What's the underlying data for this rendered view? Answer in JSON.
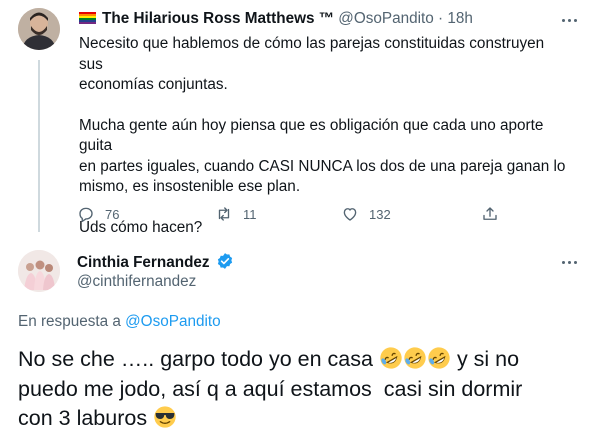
{
  "tweet": {
    "author_name": "The Hilarious Ross Matthews",
    "author_badge": "™",
    "handle": "@OsoPandito",
    "separator": "·",
    "time": "18h",
    "text_lines": [
      "Necesito que hablemos de cómo las parejas constituidas construyen sus",
      "economías conjuntas.",
      "Mucha gente aún hoy piensa que es obligación que cada uno aporte guita",
      "en partes iguales, cuando CASI NUNCA los dos de una pareja ganan lo",
      "mismo, es insostenible ese plan.",
      "Uds cómo hacen?"
    ],
    "actions": {
      "reply_count": "76",
      "retweet_count": "11",
      "like_count": "132"
    }
  },
  "reply": {
    "author_name": "Cinthia Fernandez",
    "handle": "@cinthifernandez",
    "replying_prefix": "En respuesta a",
    "replying_to": "@OsoPandito",
    "text_part1": "No se che ….. garpo todo yo en casa",
    "text_part2": "y si no",
    "text_line2": "puedo me jodo, así q a aquí estamos  casi sin dormir",
    "text_line3": "con 3 laburos",
    "emojis": [
      "rolling-on-floor-laughing",
      "rolling-on-floor-laughing",
      "rolling-on-floor-laughing",
      "smiling-face-with-sunglasses"
    ]
  },
  "colors": {
    "text": "#0f1419",
    "secondary": "#536471",
    "link": "#1d9bf0",
    "verified": "#1d9bf0"
  }
}
